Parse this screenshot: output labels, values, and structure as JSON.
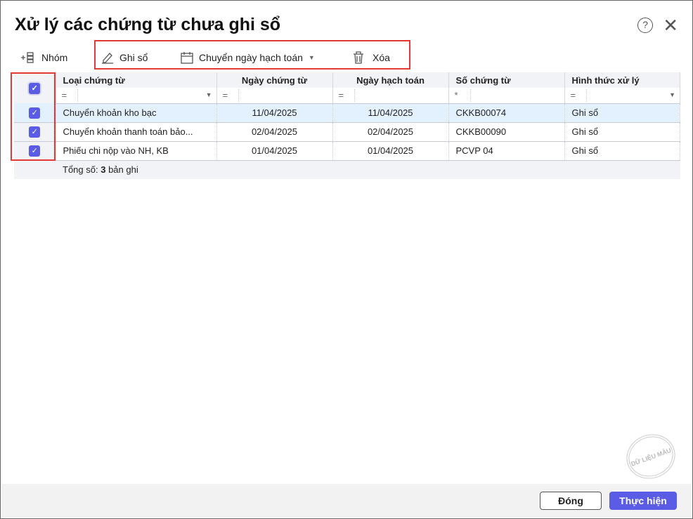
{
  "dialog": {
    "title": "Xử lý các chứng từ chưa ghi sổ"
  },
  "toolbar": {
    "group": "Nhóm",
    "post": "Ghi sổ",
    "change_date": "Chuyển ngày hạch toán",
    "delete": "Xóa"
  },
  "table": {
    "columns": [
      "Loại chứng từ",
      "Ngày chứng từ",
      "Ngày hạch toán",
      "Số chứng từ",
      "Hình thức xử lý"
    ],
    "filters": [
      "=",
      "=",
      "=",
      "*",
      "="
    ],
    "rows": [
      {
        "type": "Chuyển khoản kho bạc",
        "doc_date": "11/04/2025",
        "post_date": "11/04/2025",
        "number": "CKKB00074",
        "action": "Ghi sổ"
      },
      {
        "type": "Chuyển khoản thanh toán bảo...",
        "doc_date": "02/04/2025",
        "post_date": "02/04/2025",
        "number": "CKKB00090",
        "action": "Ghi sổ"
      },
      {
        "type": "Phiếu chi nộp vào NH, KB",
        "doc_date": "01/04/2025",
        "post_date": "01/04/2025",
        "number": "PCVP 04",
        "action": "Ghi sổ"
      }
    ],
    "total_label": "Tổng số:",
    "total_count": "3",
    "total_suffix": "bản ghi"
  },
  "footer": {
    "close": "Đóng",
    "execute": "Thực hiện"
  },
  "watermark": "DỮ LIỆU MẪU"
}
